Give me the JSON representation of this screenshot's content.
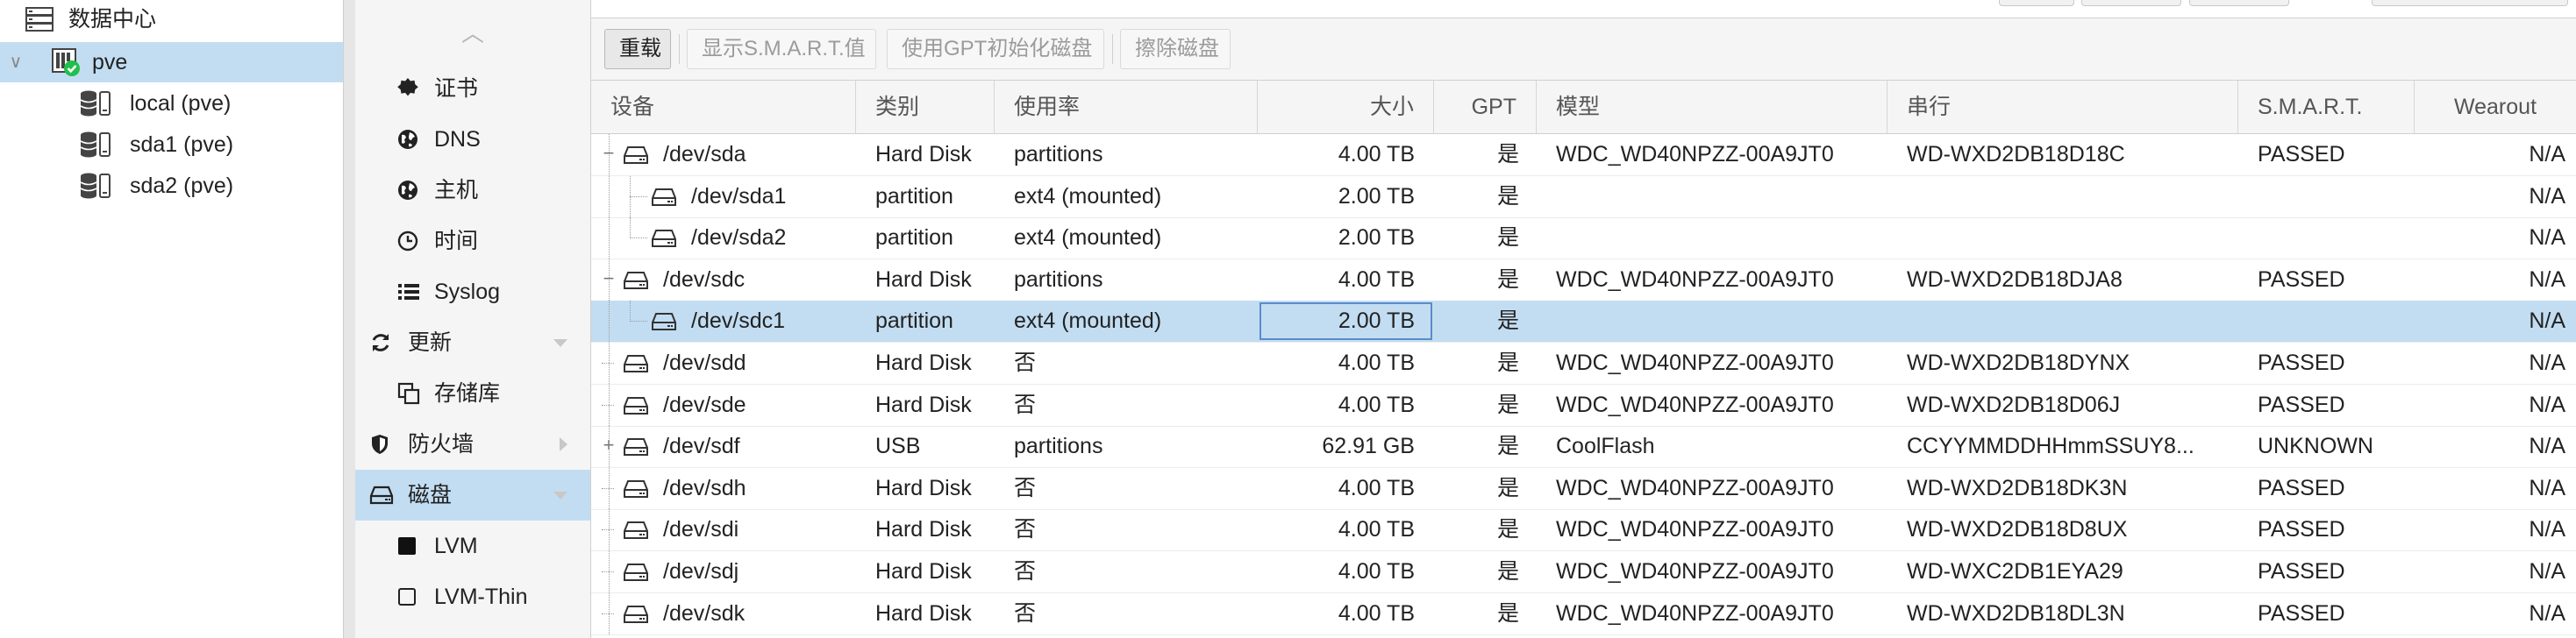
{
  "tree": {
    "items": [
      {
        "id": "datacenter",
        "label": "数据中心",
        "icon": "datacenter-icon",
        "expander": ""
      },
      {
        "id": "pve",
        "label": "pve",
        "icon": "node-online-icon",
        "expander": "∨"
      },
      {
        "id": "local",
        "label": "local (pve)",
        "icon": "storage-icon"
      },
      {
        "id": "sda1",
        "label": "sda1 (pve)",
        "icon": "storage-icon"
      },
      {
        "id": "sda2",
        "label": "sda2 (pve)",
        "icon": "storage-icon"
      }
    ]
  },
  "menu": {
    "up_arrow": "︿",
    "items": [
      {
        "id": "certs",
        "label": "证书",
        "icon": "certificate-icon",
        "indent": true
      },
      {
        "id": "dns",
        "label": "DNS",
        "icon": "globe-icon",
        "indent": true
      },
      {
        "id": "hosts",
        "label": "主机",
        "icon": "globe-icon",
        "indent": true
      },
      {
        "id": "time",
        "label": "时间",
        "icon": "clock-icon",
        "indent": true
      },
      {
        "id": "syslog",
        "label": "Syslog",
        "icon": "list-icon",
        "indent": true
      },
      {
        "id": "updates",
        "label": "更新",
        "icon": "refresh-icon",
        "indent": false,
        "caret": "down"
      },
      {
        "id": "repos",
        "label": "存储库",
        "icon": "copy-icon",
        "indent": true
      },
      {
        "id": "firewall",
        "label": "防火墙",
        "icon": "shield-icon",
        "indent": false,
        "caret": "right"
      },
      {
        "id": "disks",
        "label": "磁盘",
        "icon": "hdd-icon",
        "indent": false,
        "caret": "down",
        "selected": true
      },
      {
        "id": "lvm",
        "label": "LVM",
        "icon": "square-filled-icon",
        "indent": true
      },
      {
        "id": "lvmthin",
        "label": "LVM-Thin",
        "icon": "square-outline-icon",
        "indent": true
      }
    ]
  },
  "toolbar": {
    "reload": "重载",
    "smart": "显示S.M.A.R.T.值",
    "gpt_init": "使用GPT初始化磁盘",
    "wipe": "擦除磁盘"
  },
  "grid": {
    "columns": [
      "设备",
      "类别",
      "使用率",
      "大小",
      "GPT",
      "模型",
      "串行",
      "S.M.A.R.T.",
      "Wearout"
    ],
    "rows": [
      {
        "device": "/dev/sda",
        "type": "Hard Disk",
        "usage": "partitions",
        "size": "4.00 TB",
        "gpt": "是",
        "model": "WDC_WD40NPZZ-00A9JT0",
        "serial": "WD-WXD2DB18D18C",
        "smart": "PASSED",
        "wearout": "N/A",
        "level": 0,
        "expander": "−"
      },
      {
        "device": "/dev/sda1",
        "type": "partition",
        "usage": "ext4 (mounted)",
        "size": "2.00 TB",
        "gpt": "是",
        "model": "",
        "serial": "",
        "smart": "",
        "wearout": "N/A",
        "level": 1
      },
      {
        "device": "/dev/sda2",
        "type": "partition",
        "usage": "ext4 (mounted)",
        "size": "2.00 TB",
        "gpt": "是",
        "model": "",
        "serial": "",
        "smart": "",
        "wearout": "N/A",
        "level": 1,
        "last": true
      },
      {
        "device": "/dev/sdc",
        "type": "Hard Disk",
        "usage": "partitions",
        "size": "4.00 TB",
        "gpt": "是",
        "model": "WDC_WD40NPZZ-00A9JT0",
        "serial": "WD-WXD2DB18DJA8",
        "smart": "PASSED",
        "wearout": "N/A",
        "level": 0,
        "expander": "−"
      },
      {
        "device": "/dev/sdc1",
        "type": "partition",
        "usage": "ext4 (mounted)",
        "size": "2.00 TB",
        "gpt": "是",
        "model": "",
        "serial": "",
        "smart": "",
        "wearout": "N/A",
        "level": 1,
        "last": true,
        "selected": true
      },
      {
        "device": "/dev/sdd",
        "type": "Hard Disk",
        "usage": "否",
        "size": "4.00 TB",
        "gpt": "是",
        "model": "WDC_WD40NPZZ-00A9JT0",
        "serial": "WD-WXD2DB18DYNX",
        "smart": "PASSED",
        "wearout": "N/A",
        "level": 0
      },
      {
        "device": "/dev/sde",
        "type": "Hard Disk",
        "usage": "否",
        "size": "4.00 TB",
        "gpt": "是",
        "model": "WDC_WD40NPZZ-00A9JT0",
        "serial": "WD-WXD2DB18D06J",
        "smart": "PASSED",
        "wearout": "N/A",
        "level": 0
      },
      {
        "device": "/dev/sdf",
        "type": "USB",
        "usage": "partitions",
        "size": "62.91 GB",
        "gpt": "是",
        "model": "CoolFlash",
        "serial": "CCYYMMDDHHmmSSUY8...",
        "smart": "UNKNOWN",
        "wearout": "N/A",
        "level": 0,
        "expander": "+"
      },
      {
        "device": "/dev/sdh",
        "type": "Hard Disk",
        "usage": "否",
        "size": "4.00 TB",
        "gpt": "是",
        "model": "WDC_WD40NPZZ-00A9JT0",
        "serial": "WD-WXD2DB18DK3N",
        "smart": "PASSED",
        "wearout": "N/A",
        "level": 0
      },
      {
        "device": "/dev/sdi",
        "type": "Hard Disk",
        "usage": "否",
        "size": "4.00 TB",
        "gpt": "是",
        "model": "WDC_WD40NPZZ-00A9JT0",
        "serial": "WD-WXD2DB18D8UX",
        "smart": "PASSED",
        "wearout": "N/A",
        "level": 0
      },
      {
        "device": "/dev/sdj",
        "type": "Hard Disk",
        "usage": "否",
        "size": "4.00 TB",
        "gpt": "是",
        "model": "WDC_WD40NPZZ-00A9JT0",
        "serial": "WD-WXC2DB1EYA29",
        "smart": "PASSED",
        "wearout": "N/A",
        "level": 0
      },
      {
        "device": "/dev/sdk",
        "type": "Hard Disk",
        "usage": "否",
        "size": "4.00 TB",
        "gpt": "是",
        "model": "WDC_WD40NPZZ-00A9JT0",
        "serial": "WD-WXD2DB18DL3N",
        "smart": "PASSED",
        "wearout": "N/A",
        "level": 0
      }
    ]
  },
  "colors": {
    "selection": "#c2ddf2",
    "online": "#21bf4b",
    "menu_bg": "#f5f5f5"
  }
}
